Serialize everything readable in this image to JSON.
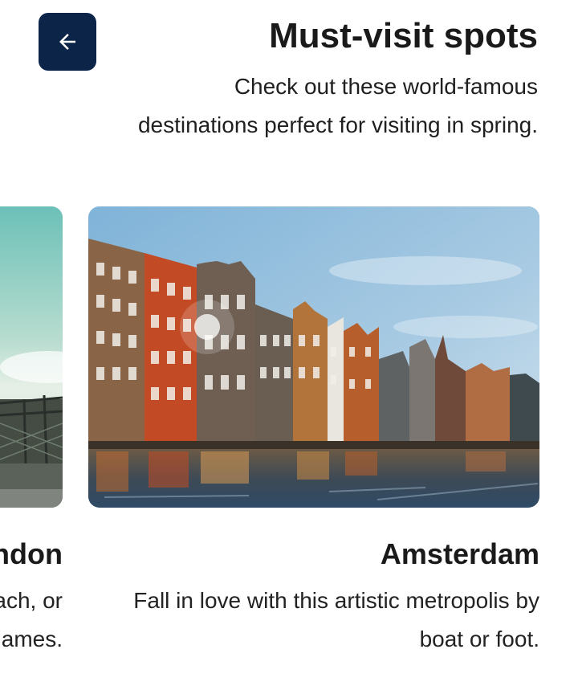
{
  "header": {
    "back_icon": "arrow-left-icon",
    "title": "Must-visit spots",
    "subtitle": "Check out these world-famous destinations perfect for visiting in spring."
  },
  "cards": [
    {
      "title": "London",
      "description": "Explore the city on foot, by bus or coach, or admire it from the Thames."
    },
    {
      "title": "Amsterdam",
      "description": "Fall in love with this artistic metropolis by boat or foot."
    }
  ],
  "colors": {
    "back_button_bg": "#0b2447",
    "text": "#1a1a1a"
  }
}
